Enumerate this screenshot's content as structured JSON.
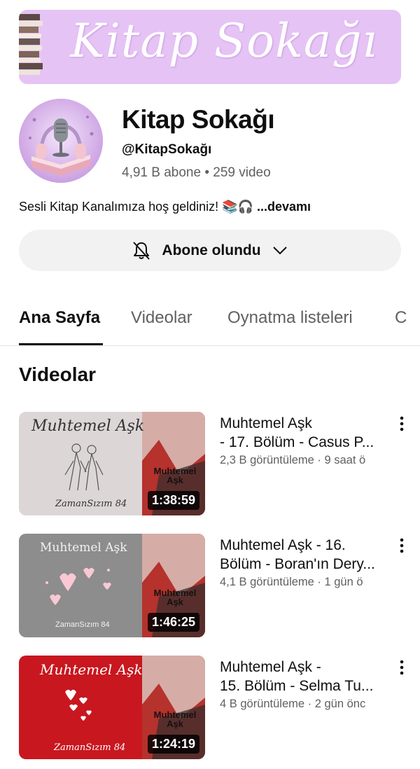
{
  "banner": {
    "title": "Kitap Sokağı"
  },
  "channel": {
    "name": "Kitap Sokağı",
    "handle": "@KitapSokağı",
    "subscribers": "4,91 B abone",
    "separator": "•",
    "video_count": "259 video",
    "description": "Sesli Kitap Kanalımıza hoş geldiniz! 📚🎧",
    "more_label": "...devamı"
  },
  "subscribe_button": {
    "label": "Abone olundu",
    "icon": "bell-off-icon"
  },
  "tabs": [
    {
      "label": "Ana Sayfa",
      "active": true
    },
    {
      "label": "Videolar",
      "active": false
    },
    {
      "label": "Oynatma listeleri",
      "active": false
    },
    {
      "label": "C",
      "active": false
    }
  ],
  "section_title": "Videolar",
  "videos": [
    {
      "title_line1": "Muhtemel Aşk",
      "title_line2": "- 17. Bölüm - Casus P...",
      "meta": "2,3 B görüntüleme · 9 saat ö",
      "duration": "1:38:59",
      "thumb_text": "Muhtemel Aşk",
      "thumb_author": "ZamanSızım 84",
      "side_text": "Muhtemel Aşk",
      "theme": "#dcd6d6"
    },
    {
      "title_line1": "Muhtemel Aşk - 16.",
      "title_line2": "Bölüm - Boran'ın Dery...",
      "meta": "4,1 B görüntüleme · 1 gün ö",
      "duration": "1:46:25",
      "thumb_text": "Muhtemel Aşk",
      "thumb_author": "ZamanSızım 84",
      "side_text": "Muhtemel Aşk",
      "theme": "#8d8d8d"
    },
    {
      "title_line1": "Muhtemel Aşk -",
      "title_line2": "15. Bölüm - Selma Tu...",
      "meta": "4 B görüntüleme · 2 gün önc",
      "duration": "1:24:19",
      "thumb_text": "Muhtemel Aşk",
      "thumb_author": "ZamanSızım 84",
      "side_text": "Muhtemel Aşk",
      "theme": "#c8171f"
    }
  ]
}
